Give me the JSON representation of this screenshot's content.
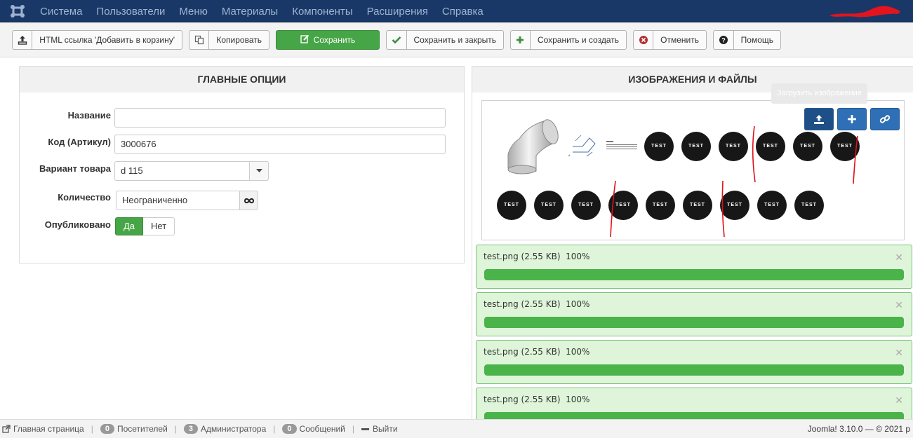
{
  "topbar": {
    "menu": [
      "Система",
      "Пользователи",
      "Меню",
      "Материалы",
      "Компоненты",
      "Расширения",
      "Справка"
    ]
  },
  "toolbar": {
    "html_link_label": "HTML ссылка 'Добавить в корзину'",
    "copy_label": "Копировать",
    "save_label": "Сохранить",
    "save_close_label": "Сохранить и закрыть",
    "save_new_label": "Сохранить и создать",
    "cancel_label": "Отменить",
    "help_label": "Помощь"
  },
  "main_options": {
    "title": "ГЛАВНЫЕ ОПЦИИ",
    "name_label": "Название",
    "name_value": "",
    "code_label": "Код (Артикул)",
    "code_value": "3000676",
    "variant_label": "Вариант товара",
    "variant_value": "d 115",
    "quantity_label": "Количество",
    "quantity_value": "Неограниченно",
    "published_label": "Опубликовано",
    "published_yes": "Да",
    "published_no": "Нет"
  },
  "images": {
    "title": "ИЗОБРАЖЕНИЯ И ФАЙЛЫ",
    "tooltip": "Загрузить изображение",
    "thumb_text": "TEST",
    "uploads": [
      {
        "name": "test.png (2.55 KB)",
        "percent": "100%",
        "progress": 1.0
      },
      {
        "name": "test.png (2.55 KB)",
        "percent": "100%",
        "progress": 1.0
      },
      {
        "name": "test.png (2.55 KB)",
        "percent": "100%",
        "progress": 1.0
      },
      {
        "name": "test.png (2.55 KB)",
        "percent": "100%",
        "progress": 1.0
      }
    ]
  },
  "status": {
    "home": "Главная страница",
    "visitors_count": "0",
    "visitors": "Посетителей",
    "admins_count": "3",
    "admins": "Администратора",
    "messages_count": "0",
    "messages": "Сообщений",
    "logout": "Выйти",
    "version": "Joomla! 3.10.0  —  © 2021 р"
  },
  "colors": {
    "topbar": "#1a3867",
    "save_green": "#46a546",
    "upload_blue": "#2f6fb5"
  }
}
